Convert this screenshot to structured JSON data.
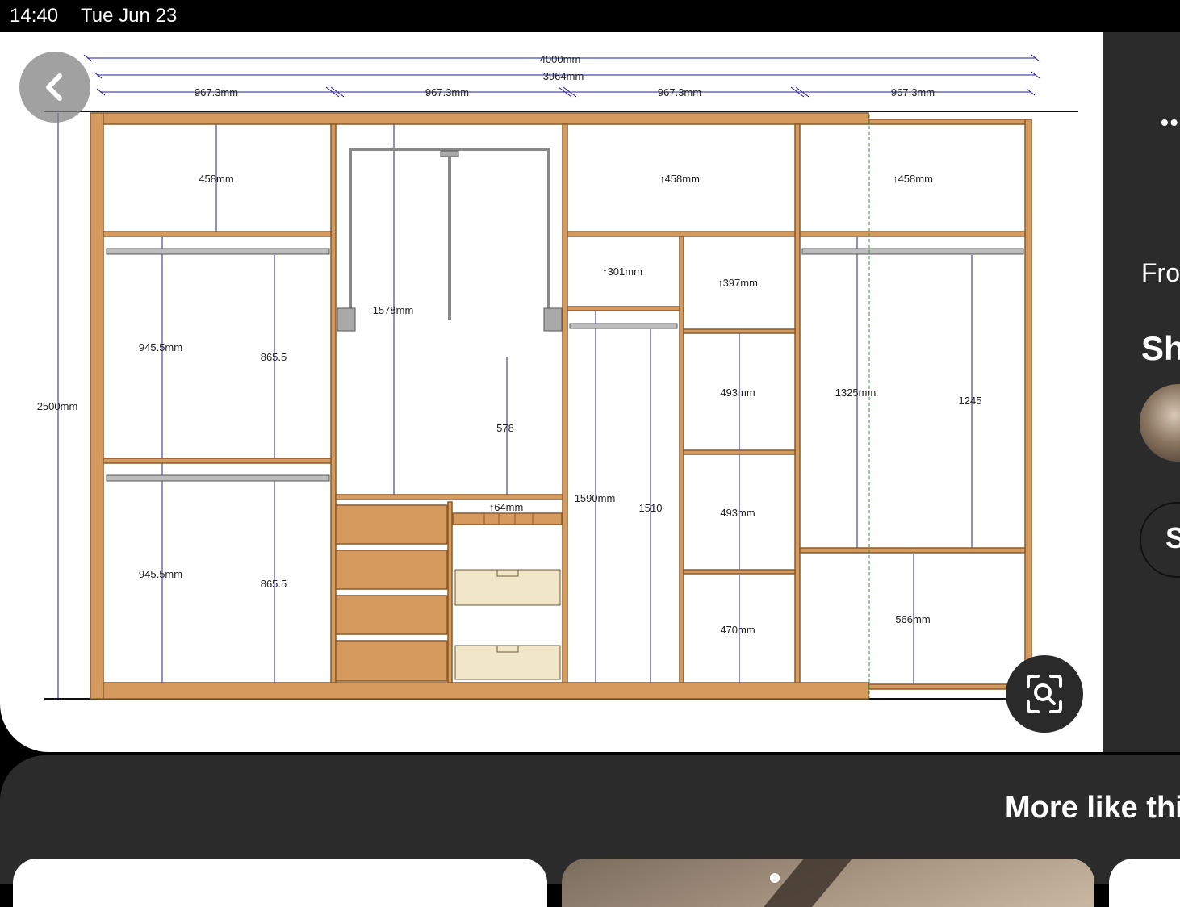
{
  "status_bar": {
    "time": "14:40",
    "date": "Tue Jun 23"
  },
  "pin": {
    "drawing": {
      "overall_width": "4000mm",
      "inner_width": "3964mm",
      "section_width": "967.3mm",
      "height": "2500mm",
      "sections": {
        "s1": {
          "top": "458mm",
          "upper_outer": "945.5mm",
          "upper_inner": "865.5",
          "lower_outer": "945.5mm",
          "lower_inner": "865.5"
        },
        "s2": {
          "hang": "1578mm",
          "inner": "578",
          "drawer_gap": "↑64mm"
        },
        "s3": {
          "top": "↑458mm",
          "shelf": "↑301mm",
          "hang_outer": "1590mm",
          "hang_inner": "1510"
        },
        "s4": {
          "shelf": "↑397mm",
          "c1": "493mm",
          "c2": "493mm",
          "c3": "470mm"
        },
        "s5": {
          "top": "↑458mm",
          "hang_outer": "1325mm",
          "hang_inner": "1245",
          "bottom": "566mm"
        }
      }
    }
  },
  "side_panel": {
    "from_label": "Fro",
    "share_label": "Sh",
    "save_label": "S"
  },
  "more_like_this": {
    "title": "More like thi"
  },
  "icons": {
    "back": "chevron-left-icon",
    "lens": "visual-search-icon",
    "more": "more-dots-icon"
  },
  "colors": {
    "wood": "#D49A5E",
    "wood_edge": "#8A5A2B",
    "dim_line": "#1F1FA0",
    "rail": "#A9A9A9",
    "basket": "#F2E6C8"
  }
}
